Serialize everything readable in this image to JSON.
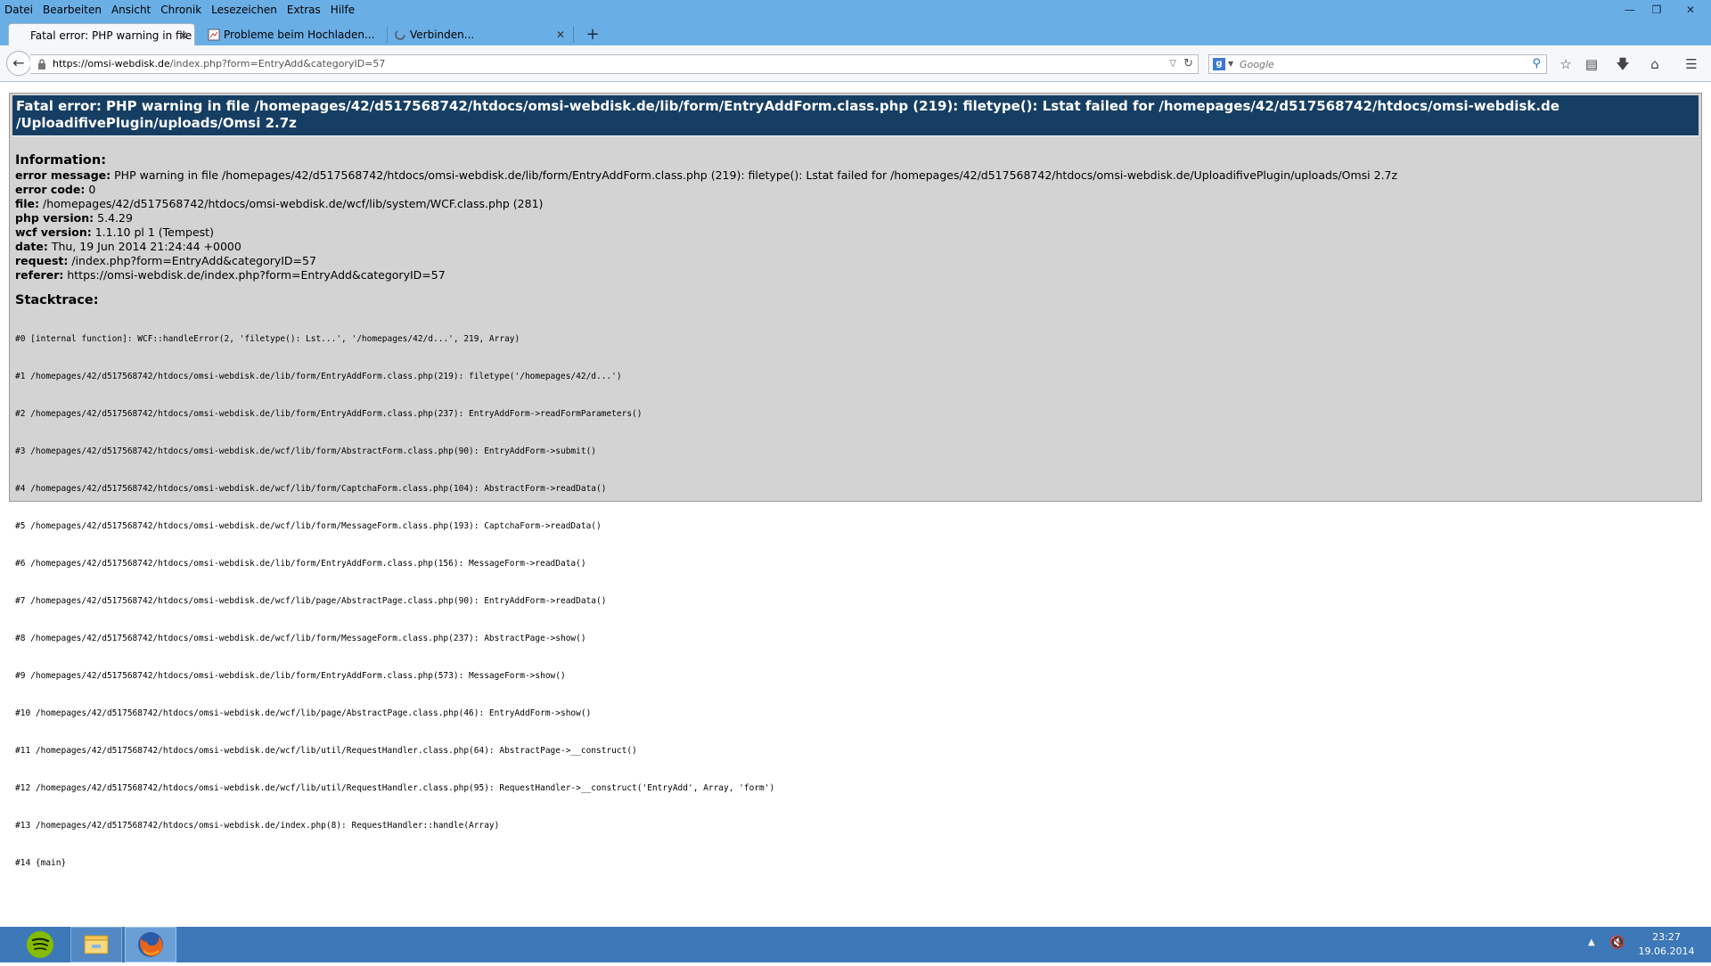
{
  "menubar": {
    "items": [
      "Datei",
      "Bearbeiten",
      "Ansicht",
      "Chronik",
      "Lesezeichen",
      "Extras",
      "Hilfe"
    ]
  },
  "tabs": [
    {
      "label": "Fatal error: PHP warning in file ...",
      "active": true
    },
    {
      "label": "Probleme beim Hochladen...",
      "active": false
    },
    {
      "label": "Verbinden...",
      "active": false
    }
  ],
  "navbar": {
    "url_host": "https://omsi-webdisk.de",
    "url_path": "/index.php?form=EntryAdd&categoryID=57",
    "search_placeholder": "Google"
  },
  "error": {
    "title": "Fatal error: PHP warning in file /homepages/42/d517568742/htdocs/omsi-webdisk.de/lib/form/EntryAddForm.class.php (219): filetype(): Lstat failed for /homepages/42/d517568742/htdocs/omsi-webdisk.de /UploadifivePlugin/uploads/Omsi 2.7z",
    "information_heading": "Information:",
    "info": [
      {
        "key": "error message:",
        "value": "PHP warning in file /homepages/42/d517568742/htdocs/omsi-webdisk.de/lib/form/EntryAddForm.class.php (219): filetype(): Lstat failed for /homepages/42/d517568742/htdocs/omsi-webdisk.de/UploadifivePlugin/uploads/Omsi 2.7z"
      },
      {
        "key": "error code:",
        "value": "0"
      },
      {
        "key": "file:",
        "value": "/homepages/42/d517568742/htdocs/omsi-webdisk.de/wcf/lib/system/WCF.class.php (281)"
      },
      {
        "key": "php version:",
        "value": "5.4.29"
      },
      {
        "key": "wcf version:",
        "value": "1.1.10 pl 1 (Tempest)"
      },
      {
        "key": "date:",
        "value": "Thu, 19 Jun 2014 21:24:44 +0000"
      },
      {
        "key": "request:",
        "value": "/index.php?form=EntryAdd&categoryID=57"
      },
      {
        "key": "referer:",
        "value": "https://omsi-webdisk.de/index.php?form=EntryAdd&categoryID=57"
      }
    ],
    "stacktrace_heading": "Stacktrace:",
    "stacktrace": [
      "#0 [internal function]: WCF::handleError(2, 'filetype(): Lst...', '/homepages/42/d...', 219, Array)",
      "#1 /homepages/42/d517568742/htdocs/omsi-webdisk.de/lib/form/EntryAddForm.class.php(219): filetype('/homepages/42/d...')",
      "#2 /homepages/42/d517568742/htdocs/omsi-webdisk.de/lib/form/EntryAddForm.class.php(237): EntryAddForm->readFormParameters()",
      "#3 /homepages/42/d517568742/htdocs/omsi-webdisk.de/wcf/lib/form/AbstractForm.class.php(90): EntryAddForm->submit()",
      "#4 /homepages/42/d517568742/htdocs/omsi-webdisk.de/wcf/lib/form/CaptchaForm.class.php(104): AbstractForm->readData()",
      "#5 /homepages/42/d517568742/htdocs/omsi-webdisk.de/wcf/lib/form/MessageForm.class.php(193): CaptchaForm->readData()",
      "#6 /homepages/42/d517568742/htdocs/omsi-webdisk.de/lib/form/EntryAddForm.class.php(156): MessageForm->readData()",
      "#7 /homepages/42/d517568742/htdocs/omsi-webdisk.de/wcf/lib/page/AbstractPage.class.php(90): EntryAddForm->readData()",
      "#8 /homepages/42/d517568742/htdocs/omsi-webdisk.de/wcf/lib/form/MessageForm.class.php(237): AbstractPage->show()",
      "#9 /homepages/42/d517568742/htdocs/omsi-webdisk.de/lib/form/EntryAddForm.class.php(573): MessageForm->show()",
      "#10 /homepages/42/d517568742/htdocs/omsi-webdisk.de/wcf/lib/page/AbstractPage.class.php(46): EntryAddForm->show()",
      "#11 /homepages/42/d517568742/htdocs/omsi-webdisk.de/wcf/lib/util/RequestHandler.class.php(64): AbstractPage->__construct()",
      "#12 /homepages/42/d517568742/htdocs/omsi-webdisk.de/wcf/lib/util/RequestHandler.class.php(95): RequestHandler->__construct('EntryAdd', Array, 'form')",
      "#13 /homepages/42/d517568742/htdocs/omsi-webdisk.de/index.php(8): RequestHandler::handle(Array)",
      "#14 {main}"
    ]
  },
  "taskbar": {
    "apps": [
      {
        "name": "spotify-icon"
      },
      {
        "name": "file-explorer-icon"
      },
      {
        "name": "firefox-icon"
      }
    ],
    "time": "23:27",
    "date": "19.06.2014"
  },
  "colors": {
    "chrome_blue": "#6aaee6",
    "error_header": "#163e63",
    "error_box": "#d3d3d3",
    "taskbar": "#3d78b8"
  }
}
